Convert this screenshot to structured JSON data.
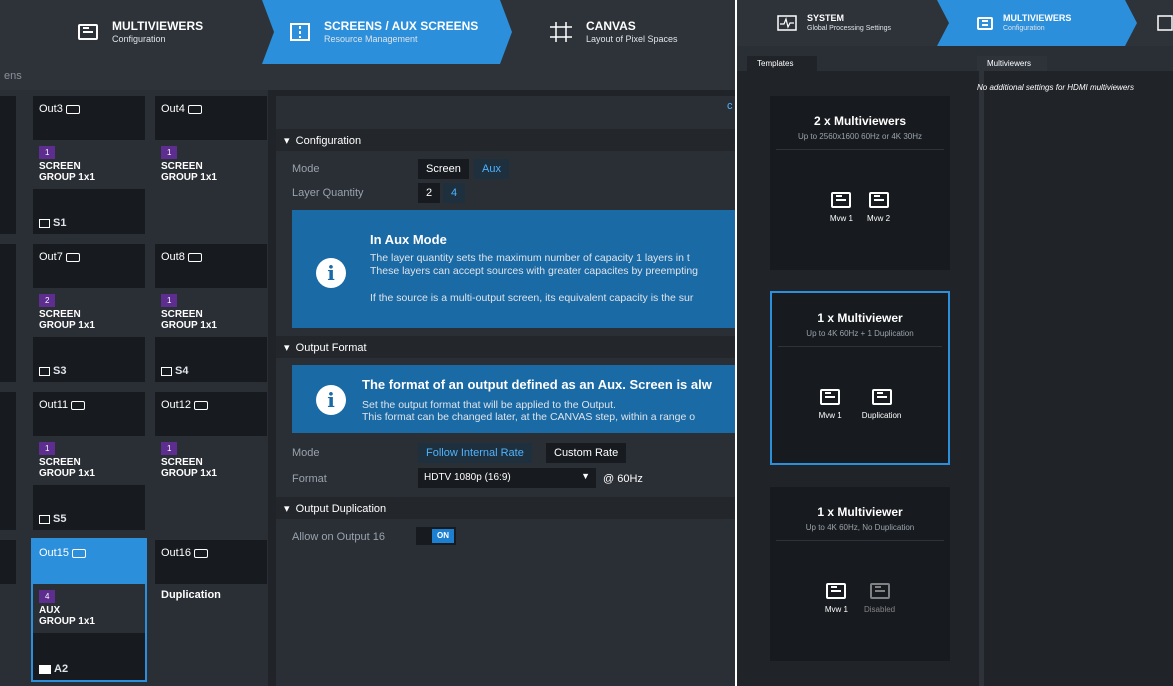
{
  "left": {
    "tabs": [
      {
        "title": "MULTIVIEWERS",
        "sub": "Configuration",
        "icon": "monitor-icon"
      },
      {
        "title": "SCREENS / AUX SCREENS",
        "sub": "Resource Management",
        "icon": "screens-icon"
      },
      {
        "title": "CANVAS",
        "sub": "Layout of Pixel Spaces",
        "icon": "canvas-grid-icon"
      }
    ],
    "subbar": "ens",
    "outputs": [
      {
        "name": "Out3",
        "badge": "1",
        "type": "SCREEN",
        "group": "GROUP 1x1",
        "foot": "S1"
      },
      {
        "name": "Out4",
        "badge": "1",
        "type": "SCREEN",
        "group": "GROUP 1x1",
        "foot": ""
      },
      {
        "name": "Out7",
        "badge": "2",
        "type": "SCREEN",
        "group": "GROUP 1x1",
        "foot": "S3"
      },
      {
        "name": "Out8",
        "badge": "1",
        "type": "SCREEN",
        "group": "GROUP 1x1",
        "foot": "S4"
      },
      {
        "name": "Out11",
        "badge": "1",
        "type": "SCREEN",
        "group": "GROUP 1x1",
        "foot": "S5"
      },
      {
        "name": "Out12",
        "badge": "1",
        "type": "SCREEN",
        "group": "GROUP 1x1",
        "foot": ""
      },
      {
        "name": "Out15",
        "badge": "4",
        "type": "AUX",
        "group": "GROUP 1x1",
        "foot": "A2"
      },
      {
        "name": "Out16",
        "badge": "",
        "type": "Duplication",
        "group": "",
        "foot": ""
      }
    ],
    "config": {
      "section": "Configuration",
      "mode_label": "Mode",
      "mode_opts": [
        "Screen",
        "Aux"
      ],
      "layer_label": "Layer Quantity",
      "layer_opts": [
        "2",
        "4"
      ],
      "info_title": "In Aux Mode",
      "info_l1": "The layer quantity sets the maximum number of capacity 1 layers in t",
      "info_l2": "These layers can accept sources with greater capacites by preempting",
      "info_l3": "If the source is a multi-output screen, its equivalent capacity is the sur"
    },
    "output_format": {
      "section": "Output Format",
      "info_title": "The format of an output defined as an Aux. Screen is alw",
      "info_l1": "Set the output format that will be applied to the Output.",
      "info_l2": "This format can be changed later, at the CANVAS step, within a range o",
      "mode_label": "Mode",
      "mode_opts": [
        "Follow Internal Rate",
        "Custom Rate"
      ],
      "format_label": "Format",
      "format_value": "HDTV 1080p (16:9)",
      "rate": "@ 60Hz"
    },
    "dup": {
      "section": "Output Duplication",
      "label": "Allow on Output 16",
      "toggle": "ON"
    }
  },
  "right": {
    "tabs": [
      {
        "title": "SYSTEM",
        "sub": "Global Processing Settings",
        "icon": "system-icon"
      },
      {
        "title": "MULTIVIEWERS",
        "sub": "Configuration",
        "icon": "monitor-icon"
      }
    ],
    "templates_tab": "Templates",
    "mv_tab": "Multiviewers",
    "mv_note": "No additional settings for HDMI multiviewers",
    "templates": [
      {
        "title": "2 x Multiviewers",
        "sub": "Up to 2560x1600 60Hz or 4K 30Hz",
        "m1": "Mvw 1",
        "m2": "Mvw 2"
      },
      {
        "title": "1 x Multiviewer",
        "sub": "Up to 4K 60Hz + 1 Duplication",
        "m1": "Mvw 1",
        "m2": "Duplication"
      },
      {
        "title": "1 x Multiviewer",
        "sub": "Up to 4K 60Hz, No Duplication",
        "m1": "Mvw 1",
        "m2": "Disabled"
      }
    ]
  },
  "colors": {
    "accent": "#2b8fdb",
    "badge": "#5d2d8f",
    "info": "#1a6aa6"
  }
}
